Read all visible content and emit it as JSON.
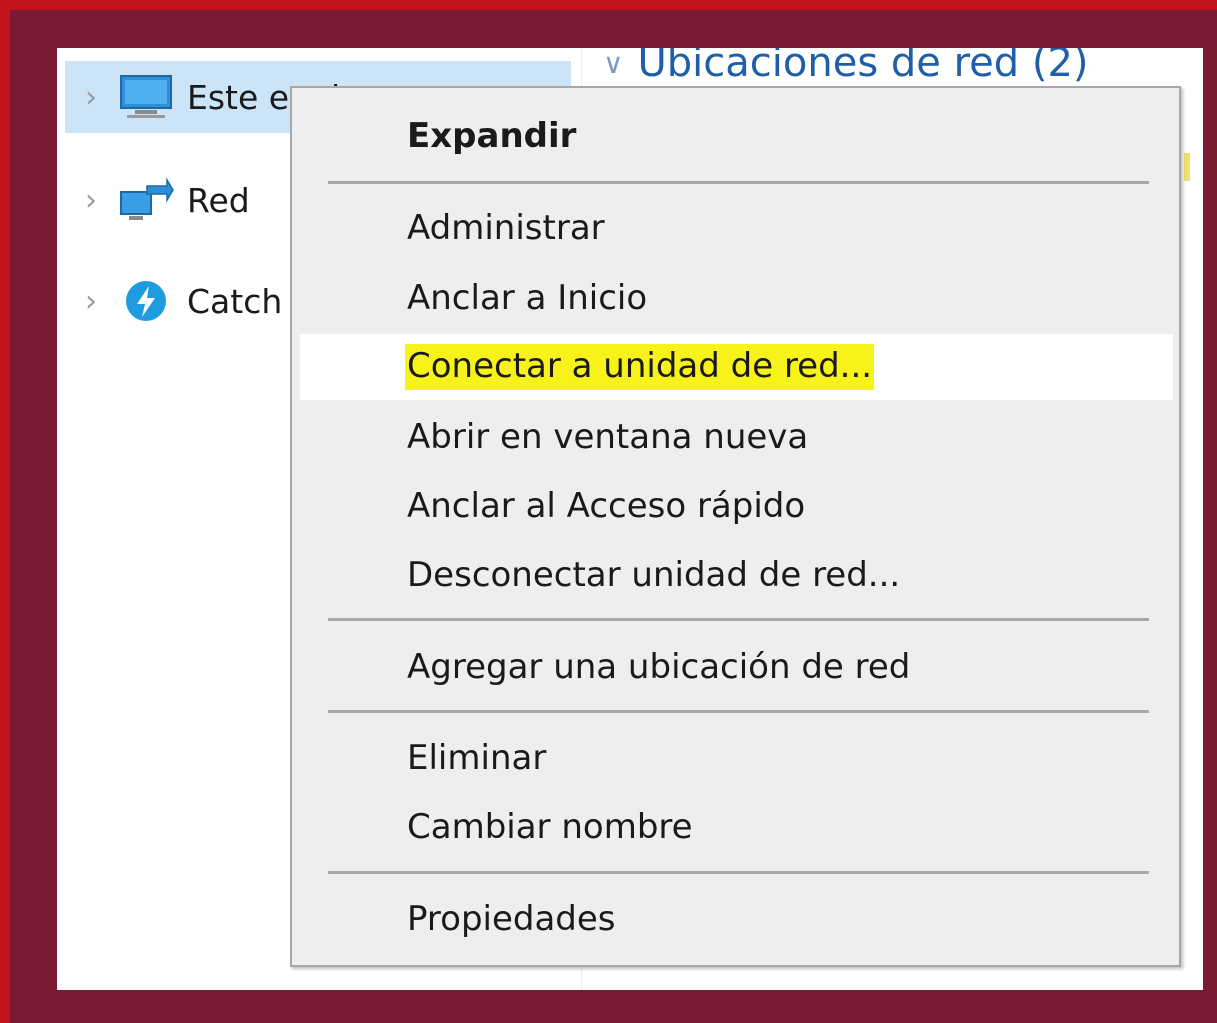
{
  "nav": {
    "items": [
      {
        "label": "Este equipo",
        "icon": "computer-icon"
      },
      {
        "label": "Red",
        "icon": "network-icon"
      },
      {
        "label": "Catch",
        "icon": "catch-app-icon"
      }
    ]
  },
  "content": {
    "group_header": "Ubicaciones de red (2)"
  },
  "context_menu": {
    "items": [
      {
        "label": "Expandir",
        "bold": true
      },
      {
        "label": "Administrar"
      },
      {
        "label": "Anclar a Inicio"
      },
      {
        "label": "Conectar a unidad de red...",
        "highlighted": true
      },
      {
        "label": "Abrir en ventana nueva"
      },
      {
        "label": "Anclar al Acceso rápido"
      },
      {
        "label": "Desconectar unidad de red..."
      },
      {
        "label": "Agregar una ubicación de red"
      },
      {
        "label": "Eliminar"
      },
      {
        "label": "Cambiar nombre"
      },
      {
        "label": "Propiedades"
      }
    ]
  },
  "colors": {
    "frame_red": "#c4121a",
    "background_maroon": "#791a32",
    "selection_blue": "#cce4f7",
    "highlight_yellow": "#f6f21a",
    "header_blue": "#1f5fa8"
  }
}
